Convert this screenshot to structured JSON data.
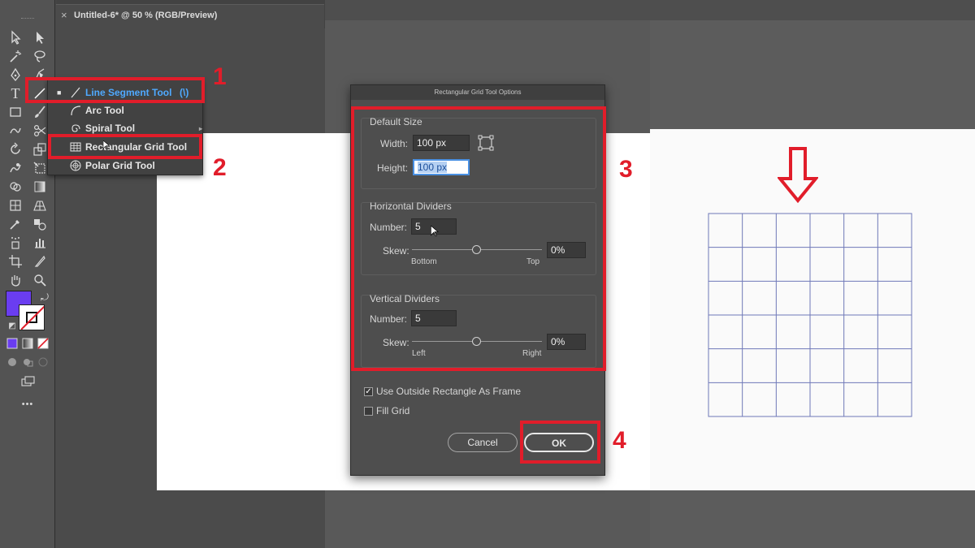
{
  "document": {
    "tab_close": "×",
    "tab_title": "Untitled-6* @ 50 % (RGB/Preview)"
  },
  "flyout": {
    "items": [
      {
        "label": "Line Segment Tool",
        "shortcut": "(\\)",
        "active": true
      },
      {
        "label": "Arc Tool"
      },
      {
        "label": "Spiral Tool"
      },
      {
        "label": "Rectangular Grid Tool"
      },
      {
        "label": "Polar Grid Tool"
      }
    ]
  },
  "steps": [
    "1",
    "2",
    "3",
    "4"
  ],
  "toolbar": {
    "more": "•••",
    "icons": [
      "selection-tool-icon",
      "direct-selection-tool-icon",
      "magic-wand-icon",
      "lasso-icon",
      "pen-tool-icon",
      "curvature-tool-icon",
      "type-tool-icon",
      "line-segment-tool-icon",
      "rectangle-tool-icon",
      "paintbrush-icon",
      "shaper-tool-icon",
      "scissors-icon",
      "rotate-tool-icon",
      "scale-tool-icon",
      "warp-tool-icon",
      "free-transform-icon",
      "shape-builder-icon",
      "gradient-tool-icon",
      "mesh-tool-icon",
      "perspective-grid-icon",
      "eyedropper-icon",
      "blend-tool-icon",
      "symbol-sprayer-icon",
      "column-graph-icon",
      "artboard-tool-icon",
      "slice-tool-icon",
      "hand-tool-icon",
      "zoom-tool-icon"
    ],
    "fill_color": "#6a3df0",
    "stroke": "none"
  },
  "dialog": {
    "title": "Rectangular Grid Tool Options",
    "default_size": {
      "title": "Default Size",
      "width_label": "Width:",
      "width_value": "100 px",
      "height_label": "Height:",
      "height_value": "100 px"
    },
    "horizontal": {
      "title": "Horizontal Dividers",
      "number_label": "Number:",
      "number_value": "5",
      "skew_label": "Skew:",
      "skew_value": "0%",
      "left_label": "Bottom",
      "right_label": "Top",
      "skew_fraction": 0.5
    },
    "vertical": {
      "title": "Vertical Dividers",
      "number_label": "Number:",
      "number_value": "5",
      "skew_label": "Skew:",
      "skew_value": "0%",
      "left_label": "Left",
      "right_label": "Right",
      "skew_fraction": 0.5
    },
    "use_outside_rect": {
      "label": "Use Outside Rectangle As Frame",
      "checked": true,
      "mark": "✓"
    },
    "fill_grid": {
      "label": "Fill Grid",
      "checked": false
    },
    "cancel_label": "Cancel",
    "ok_label": "OK"
  },
  "result": {
    "arrow": "down-arrow",
    "grid_rows": 6,
    "grid_cols": 6,
    "grid_color": "#6f78b8"
  },
  "colors": {
    "highlight": "#e11d2a",
    "active_text": "#4fa9ff"
  }
}
